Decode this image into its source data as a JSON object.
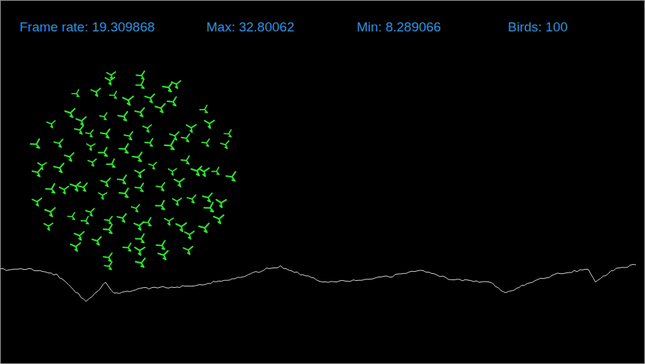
{
  "stats": [
    {
      "text": "Frame rate: 19.309868"
    },
    {
      "text": "Max: 32.80062"
    },
    {
      "text": "Min: 8.289066"
    },
    {
      "text": "Birds: 100"
    }
  ]
}
